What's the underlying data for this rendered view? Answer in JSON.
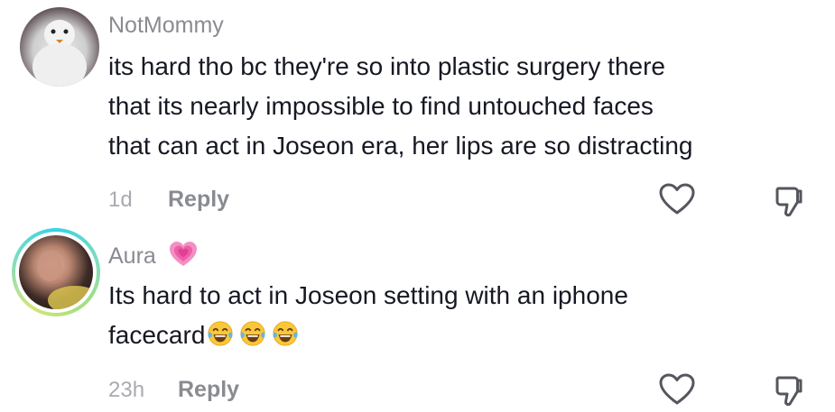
{
  "comments": [
    {
      "username": "NotMommy",
      "text_lines": [
        "its hard tho bc they're so into plastic surgery there",
        "that its nearly impossible to find untouched faces",
        "that can act in Joseon era, her lips are so distracting"
      ],
      "time": "1d",
      "reply_label": "Reply"
    },
    {
      "username": "Aura",
      "name_badge": "growing-heart-emoji",
      "text_lines": [
        "Its hard to act in Joseon setting with an iphone",
        "facecard"
      ],
      "trailing_emojis": [
        "laughing-tears-emoji",
        "laughing-tears-emoji",
        "laughing-tears-emoji"
      ],
      "time": "23h",
      "reply_label": "Reply"
    }
  ],
  "colors": {
    "text": "#161823",
    "username": "#8a8b91",
    "meta": "#a9aab0",
    "icon": "#55575e",
    "story_ring_start": "#34d3e6",
    "story_ring_end": "#a7e07c"
  }
}
